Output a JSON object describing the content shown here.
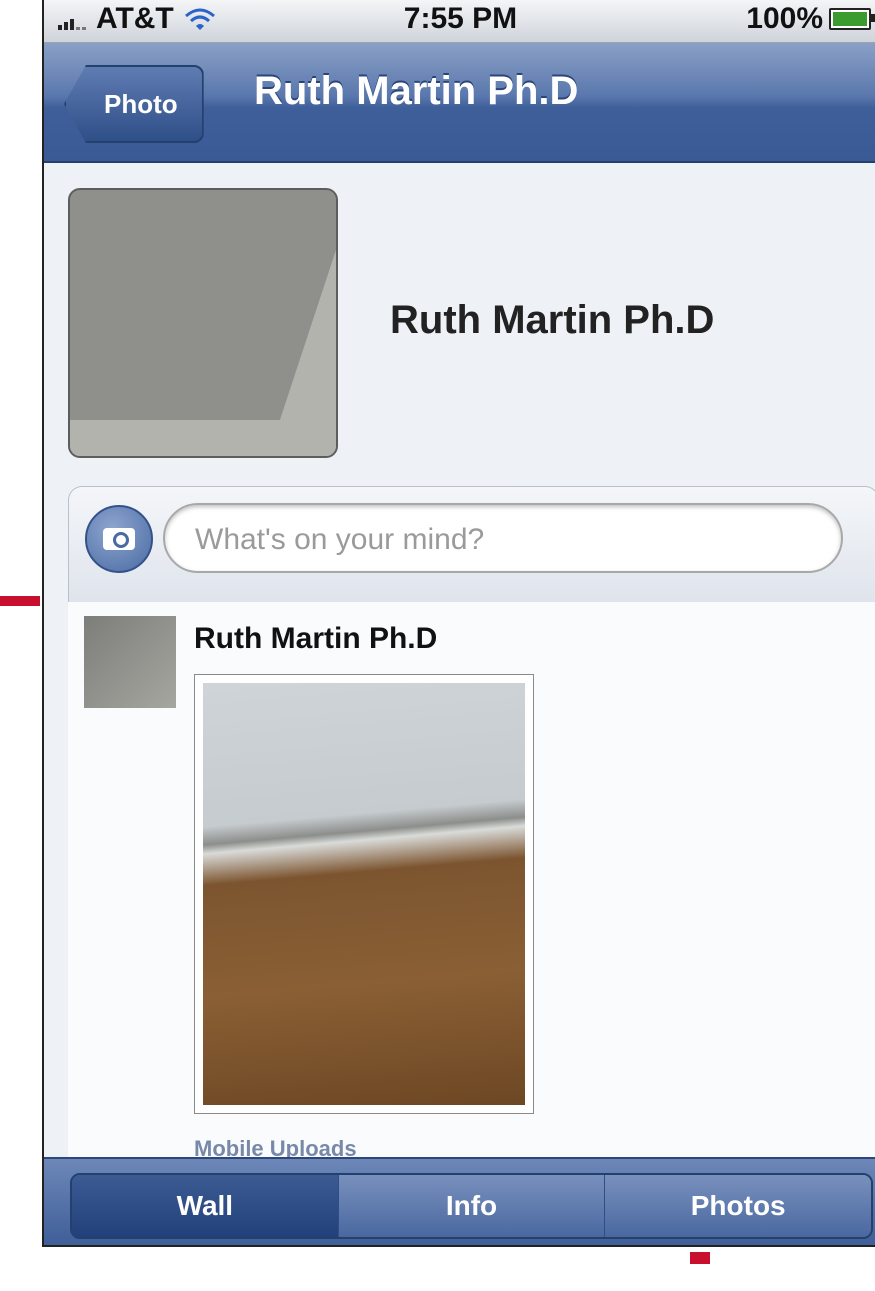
{
  "status_bar": {
    "carrier": "AT&T",
    "time": "7:55 PM",
    "battery": "100%",
    "battery_level": 1.0
  },
  "nav": {
    "back_label": "Photo",
    "title": "Ruth Martin Ph.D"
  },
  "profile": {
    "name": "Ruth Martin Ph.D"
  },
  "composer": {
    "placeholder": "What's on your mind?"
  },
  "post": {
    "author": "Ruth Martin Ph.D",
    "album": "Mobile Uploads"
  },
  "tabs": [
    {
      "label": "Wall",
      "active": true
    },
    {
      "label": "Info",
      "active": false
    },
    {
      "label": "Photos",
      "active": false
    }
  ],
  "colors": {
    "nav_blue": "#3f5f9a",
    "accent_red": "#c8102e"
  }
}
